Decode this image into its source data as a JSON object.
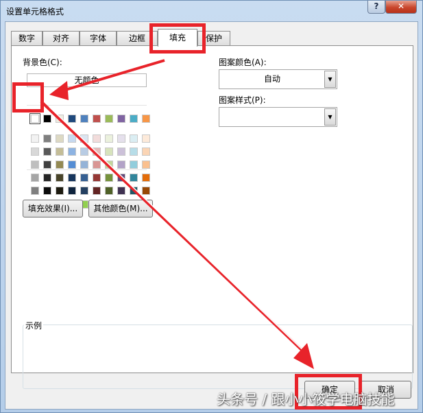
{
  "dialog": {
    "title": "设置单元格格式",
    "help_label": "?",
    "close_label": "✕"
  },
  "tabs": [
    {
      "label": "数字"
    },
    {
      "label": "对齐"
    },
    {
      "label": "字体"
    },
    {
      "label": "边框"
    },
    {
      "label": "填充",
      "active": true
    },
    {
      "label": "保护"
    }
  ],
  "fill": {
    "background_label": "背景色(C):",
    "no_color_label": "无颜色",
    "theme_row": [
      "#ffffff",
      "#000000",
      "#eeece1",
      "#1f497d",
      "#4f81bd",
      "#c0504d",
      "#9bbb59",
      "#8064a2",
      "#4bacc6",
      "#f79646"
    ],
    "shade_rows": [
      [
        "#f2f2f2",
        "#7f7f7f",
        "#ddd9c3",
        "#c6d9f0",
        "#dbe5f1",
        "#f2dcdb",
        "#ebf1dd",
        "#e5e0ec",
        "#dbeef3",
        "#fdeada"
      ],
      [
        "#d8d8d8",
        "#595959",
        "#c4bd97",
        "#8db3e2",
        "#b8cce4",
        "#e5b9b7",
        "#d7e3bc",
        "#ccc1d9",
        "#b7dde8",
        "#fbd5b5"
      ],
      [
        "#bfbfbf",
        "#3f3f3f",
        "#938953",
        "#548dd4",
        "#95b3d7",
        "#d99694",
        "#c3d69b",
        "#b2a2c7",
        "#92cddc",
        "#fac08f"
      ],
      [
        "#a5a5a5",
        "#262626",
        "#494429",
        "#17365d",
        "#366092",
        "#953734",
        "#76923c",
        "#5f497a",
        "#31859b",
        "#e36c09"
      ],
      [
        "#7f7f7f",
        "#0c0c0c",
        "#1d1b10",
        "#0f243e",
        "#244061",
        "#632423",
        "#4f6128",
        "#3f3151",
        "#205867",
        "#974806"
      ]
    ],
    "standard_row": [
      "#c00000",
      "#ff0000",
      "#ffc000",
      "#ffff00",
      "#92d050",
      "#00b050",
      "#00b0f0",
      "#0070c0",
      "#002060",
      "#7030a0"
    ],
    "fill_effects_label": "填充效果(I)...",
    "more_colors_label": "其他颜色(M)...",
    "pattern_color_label": "图案颜色(A):",
    "pattern_color_value": "自动",
    "pattern_style_label": "图案样式(P):",
    "pattern_style_value": "",
    "sample_label": "示例"
  },
  "footer": {
    "ok_label": "确定",
    "cancel_label": "取消"
  },
  "watermark": "头条号 / 跟小小筱学电脑技能",
  "colors": {
    "annotation_red": "#e8232a"
  }
}
